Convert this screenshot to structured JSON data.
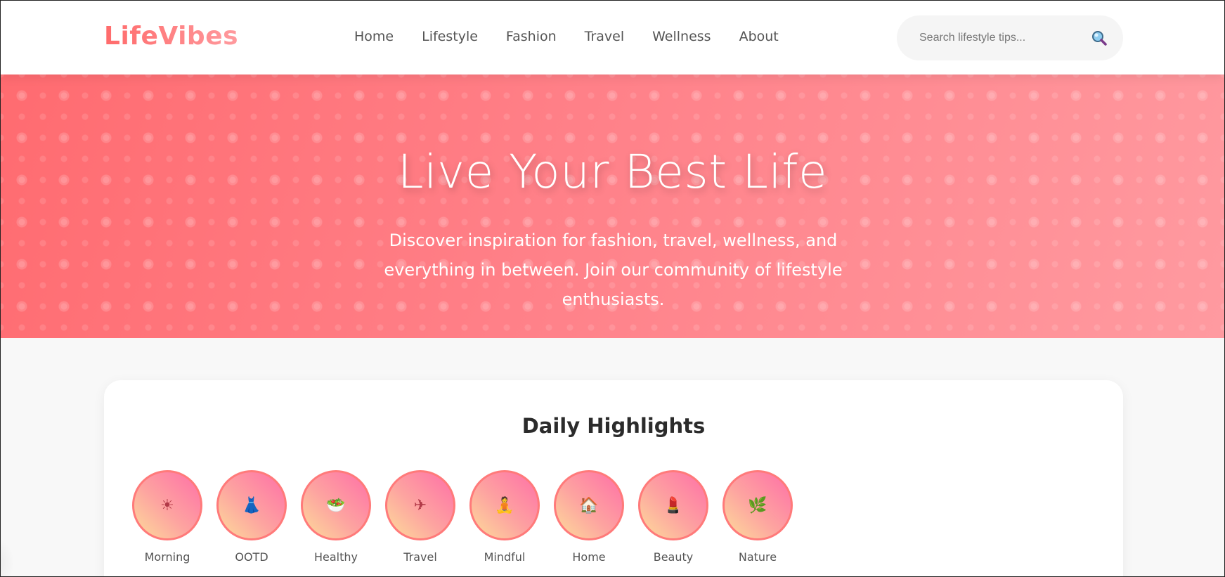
{
  "header": {
    "logo": "LifeVibes",
    "nav": [
      "Home",
      "Lifestyle",
      "Fashion",
      "Travel",
      "Wellness",
      "About"
    ],
    "search": {
      "placeholder": "Search lifestyle tips...",
      "icon": "search-icon"
    }
  },
  "hero": {
    "title": "Live Your Best Life",
    "subtitle": "Discover inspiration for fashion, travel, wellness, and everything in between. Join our community of lifestyle enthusiasts."
  },
  "highlights": {
    "title": "Daily Highlights",
    "items": [
      {
        "label": "Morning",
        "icon": "sun-icon",
        "glyph": "☀"
      },
      {
        "label": "OOTD",
        "icon": "dress-icon",
        "glyph": "👗"
      },
      {
        "label": "Healthy",
        "icon": "salad-icon",
        "glyph": "🥗"
      },
      {
        "label": "Travel",
        "icon": "airplane-icon",
        "glyph": "✈"
      },
      {
        "label": "Mindful",
        "icon": "meditation-icon",
        "glyph": "🧘"
      },
      {
        "label": "Home",
        "icon": "house-icon",
        "glyph": "🏠"
      },
      {
        "label": "Beauty",
        "icon": "lipstick-icon",
        "glyph": "💄"
      },
      {
        "label": "Nature",
        "icon": "plant-icon",
        "glyph": "🌿"
      }
    ]
  },
  "colors": {
    "brand": "#ff6b6b",
    "brand_light": "#ff9a9e",
    "story_border": "#ff7a7a"
  }
}
